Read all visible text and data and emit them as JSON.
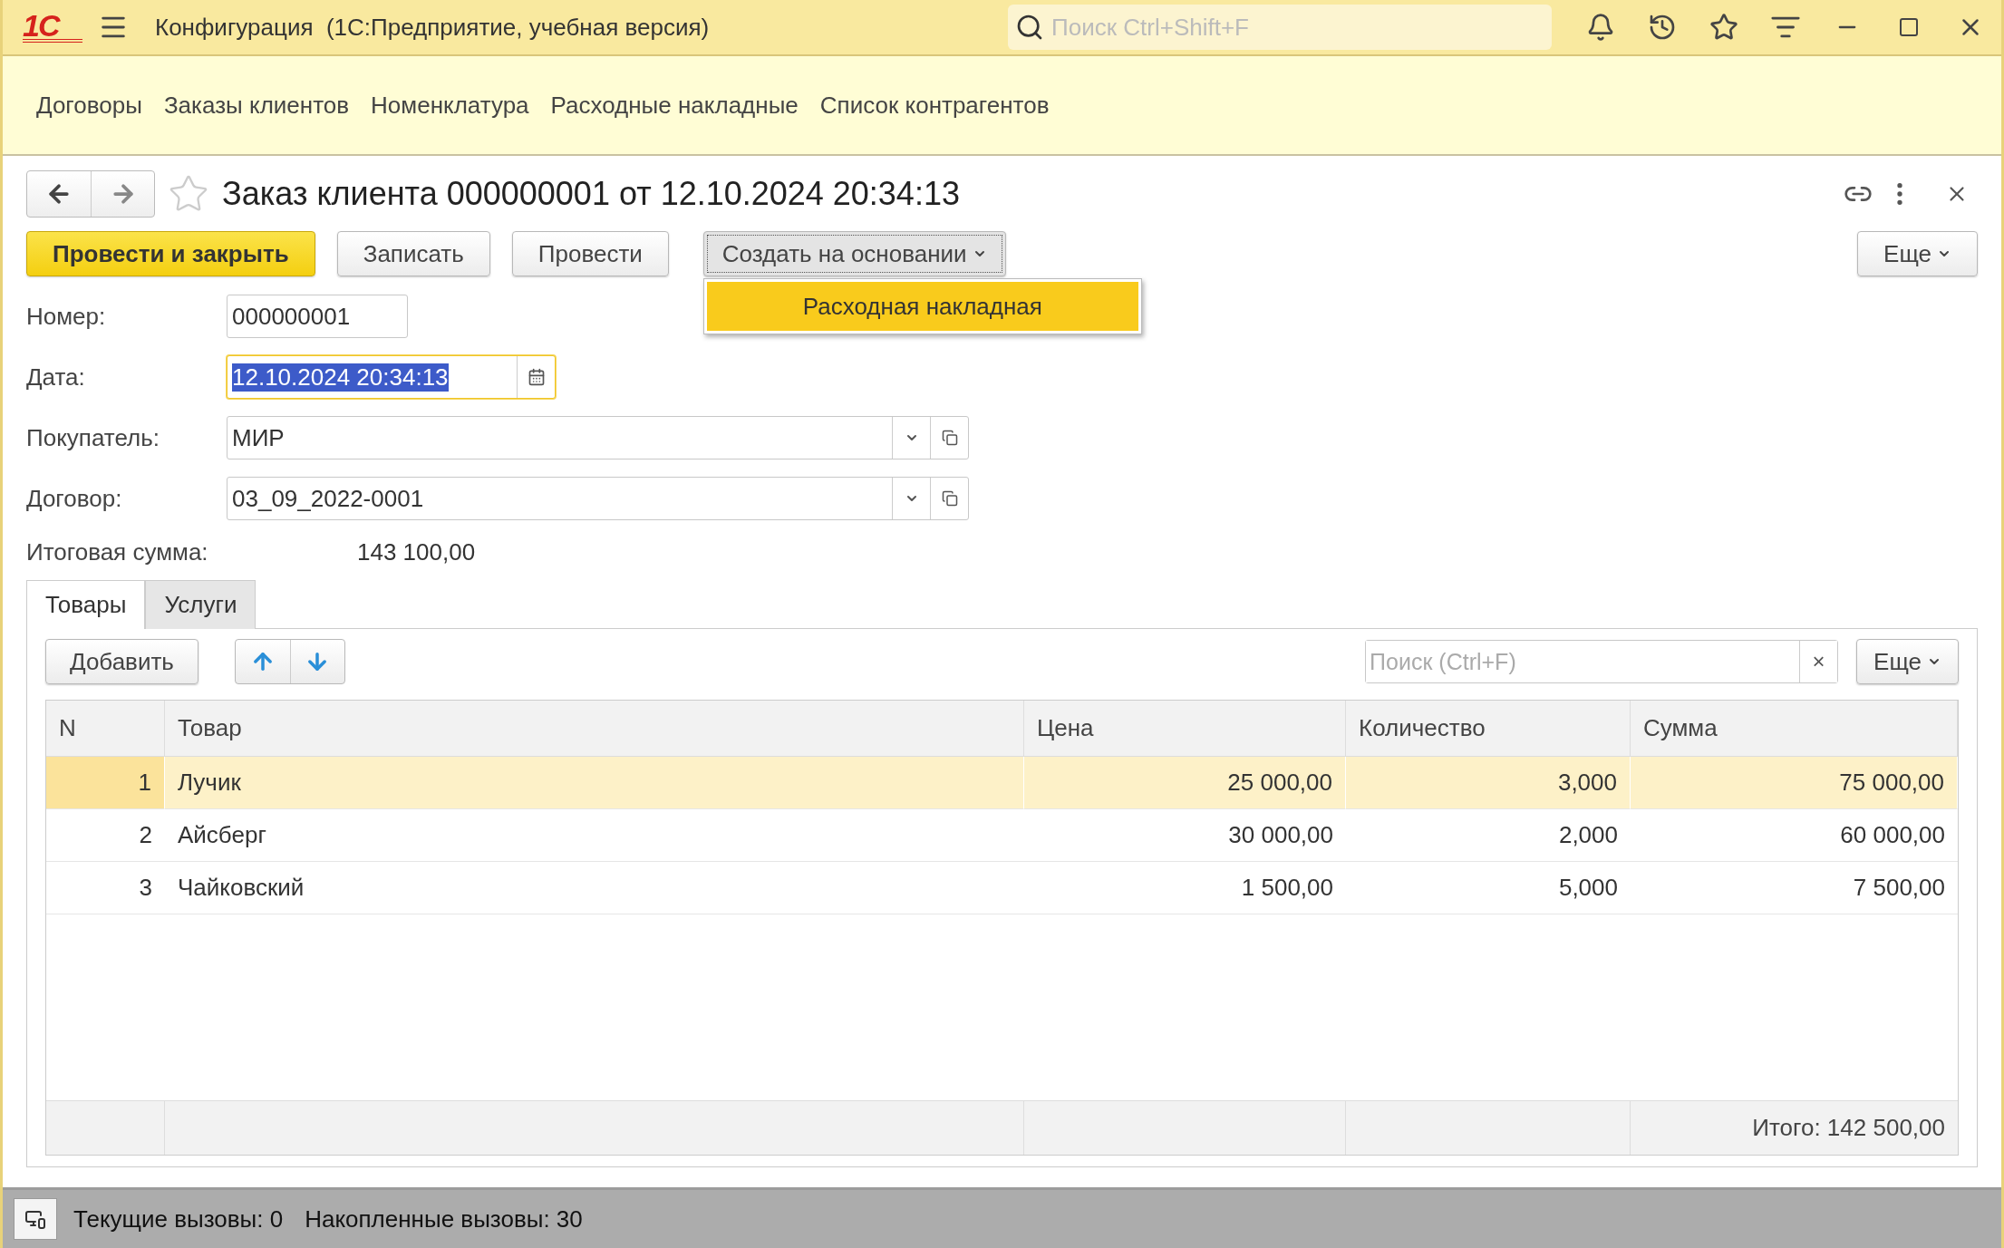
{
  "titlebar": {
    "logo": "1С",
    "title": "Конфигурация  (1С:Предприятие, учебная версия)",
    "search": {
      "placeholder": "Поиск Ctrl+Shift+F"
    }
  },
  "nav": [
    "Договоры",
    "Заказы клиентов",
    "Номенклатура",
    "Расходные накладные",
    "Список контрагентов"
  ],
  "form": {
    "title": "Заказ клиента 000000001 от 12.10.2024 20:34:13",
    "buttons": [
      {
        "label": "Провести и закрыть",
        "kind": "primary"
      },
      {
        "label": "Записать",
        "kind": "normal"
      },
      {
        "label": "Провести",
        "kind": "normal"
      },
      {
        "label": "Создать на основании",
        "kind": "menu",
        "expanded": true
      }
    ],
    "more": "Еще",
    "menu": [
      {
        "label": "Расходная накладная",
        "selected": true
      }
    ],
    "fields": [
      {
        "label": "Номер:",
        "value": "000000001",
        "kind": "short",
        "focused": false
      },
      {
        "label": "Дата:",
        "value": "12.10.2024 20:34:13",
        "kind": "date",
        "focused": true
      },
      {
        "label": "Покупатель:",
        "value": "МИР",
        "kind": "ref",
        "focused": false
      },
      {
        "label": "Договор:",
        "value": "03_09_2022-0001",
        "kind": "ref",
        "focused": false
      }
    ],
    "total": {
      "label": "Итоговая сумма:",
      "value": "143 100,00"
    },
    "tabs": [
      {
        "label": "Товары",
        "selected": true
      },
      {
        "label": "Услуги",
        "selected": false
      }
    ],
    "toolbar": {
      "add": "Добавить",
      "search": {
        "placeholder": "Поиск (Ctrl+F)"
      },
      "clear": "×",
      "more": "Еще"
    },
    "table": {
      "columns": [
        "N",
        "Товар",
        "Цена",
        "Количество",
        "Сумма"
      ],
      "rows": [
        {
          "cells": [
            "1",
            "Лучик",
            "25 000,00",
            "3,000",
            "75 000,00"
          ],
          "selected": true
        },
        {
          "cells": [
            "2",
            "Айсберг",
            "30 000,00",
            "2,000",
            "60 000,00"
          ],
          "selected": false
        },
        {
          "cells": [
            "3",
            "Чайковский",
            "1 500,00",
            "5,000",
            "7 500,00"
          ],
          "selected": false
        }
      ],
      "footer": "Итого: 142 500,00"
    }
  },
  "status_bar": {
    "current": "Текущие вызовы: 0",
    "accumulated": "Накопленные вызовы: 30"
  }
}
